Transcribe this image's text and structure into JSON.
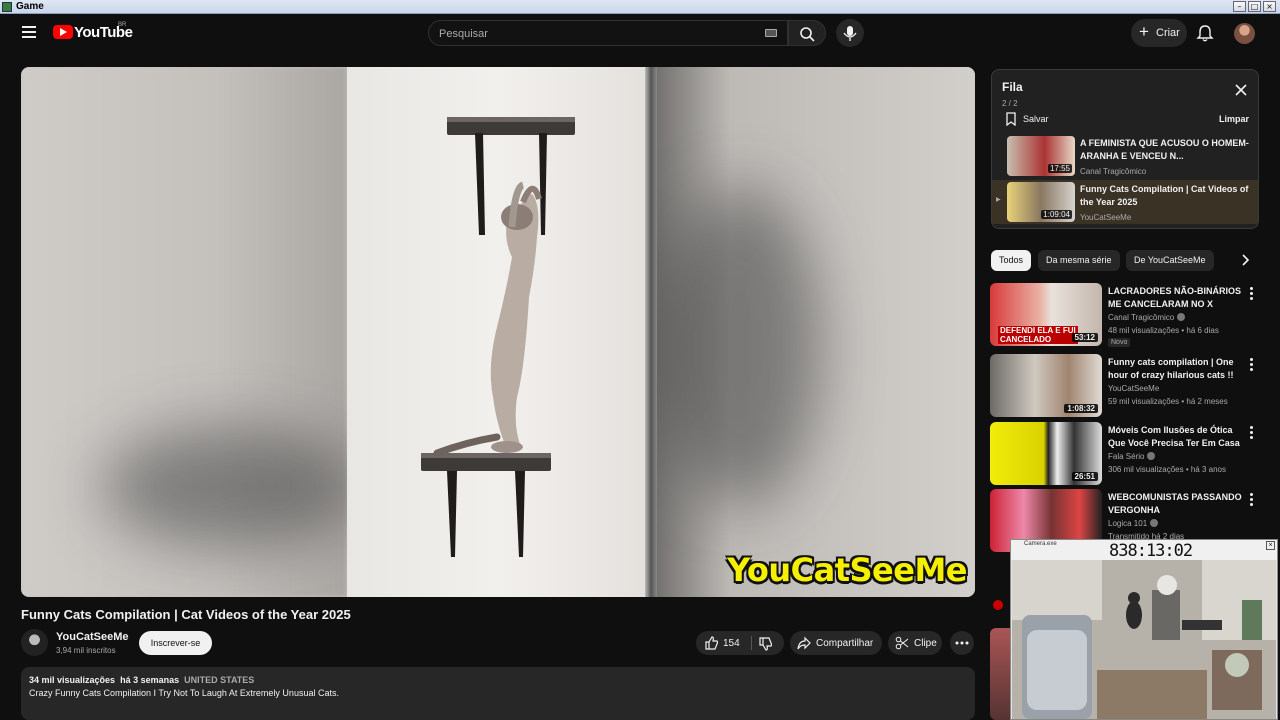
{
  "window": {
    "title": "Game"
  },
  "masthead": {
    "logo_text": "YouTube",
    "region": "BR",
    "search_placeholder": "Pesquisar",
    "create_label": "Criar"
  },
  "video": {
    "title": "Funny Cats Compilation | Cat Videos of the Year 2025",
    "watermark": "YouCatSeeMe",
    "channel": "YouCatSeeMe",
    "subscribers": "3,94 mil inscritos",
    "subscribe_label": "Inscrever-se",
    "likes": "154",
    "share_label": "Compartilhar",
    "clip_label": "Clipe",
    "views": "34 mil visualizações",
    "age": "há 3 semanas",
    "location": "UNITED STATES",
    "description": "Crazy Funny Cats Compilation I Try Not To Laugh At Extremely Unusual Cats."
  },
  "queue": {
    "title": "Fila",
    "count": "2 / 2",
    "save_label": "Salvar",
    "clear_label": "Limpar",
    "items": [
      {
        "title": "A FEMINISTA QUE ACUSOU O HOMEM-ARANHA E VENCEU N...",
        "channel": "Canal Tragicômico",
        "duration": "17:55",
        "active": false
      },
      {
        "title": "Funny Cats Compilation | Cat Videos of the Year 2025",
        "channel": "YouCatSeeMe",
        "duration": "1:09:04",
        "active": true
      }
    ]
  },
  "chips": [
    "Todos",
    "Da mesma série",
    "De YouCatSeeMe"
  ],
  "recommendations": [
    {
      "title": "LACRADORES NÃO-BINÁRIOS ME CANCELARAM NO X",
      "channel": "Canal Tragicômico",
      "meta": "48 mil visualizações • há 6 dias",
      "badge": "Novo",
      "duration": "53:12",
      "thumb_text": "DEFENDI ELA E FUI CANCELADO"
    },
    {
      "title": "Funny cats compilation | One hour of crazy hilarious cats !!",
      "channel": "YouCatSeeMe",
      "meta": "59 mil visualizações • há 2 meses",
      "duration": "1:08:32"
    },
    {
      "title": "Móveis Com Ilusões de Ótica Que Você Precisa Ter Em Casa",
      "channel": "Fala Sério",
      "meta": "306 mil visualizações • há 3 anos",
      "duration": "26:51"
    },
    {
      "title": "WEBCOMUNISTAS PASSANDO VERGONHA",
      "channel": "Logica 101",
      "meta": "Transmitido há 2 dias",
      "duration": ""
    }
  ],
  "overlay": {
    "title": "Camera.exe",
    "time": "838:13:02"
  },
  "colors": {
    "accent": "#ff0000",
    "watermark": "#f5f000",
    "background": "#0f0f0f"
  }
}
